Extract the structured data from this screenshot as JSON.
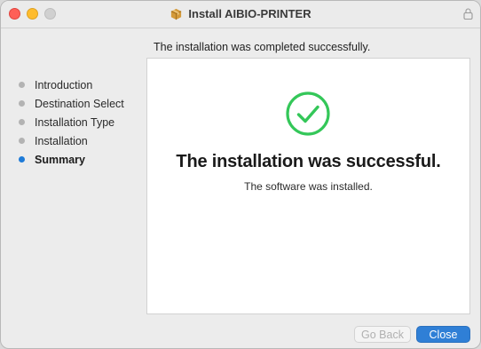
{
  "window": {
    "title": "Install AIBIO-PRINTER"
  },
  "header": {
    "message": "The installation was completed successfully."
  },
  "sidebar": {
    "steps": [
      {
        "label": "Introduction",
        "active": false
      },
      {
        "label": "Destination Select",
        "active": false
      },
      {
        "label": "Installation Type",
        "active": false
      },
      {
        "label": "Installation",
        "active": false
      },
      {
        "label": "Summary",
        "active": true
      }
    ]
  },
  "content": {
    "title": "The installation was successful.",
    "subtitle": "The software was installed.",
    "icon": "checkmark-circle-icon"
  },
  "buttons": {
    "go_back": "Go Back",
    "close": "Close"
  },
  "colors": {
    "accent": "#2f7fd6",
    "success": "#34c759",
    "active_dot": "#1e7bd8"
  }
}
